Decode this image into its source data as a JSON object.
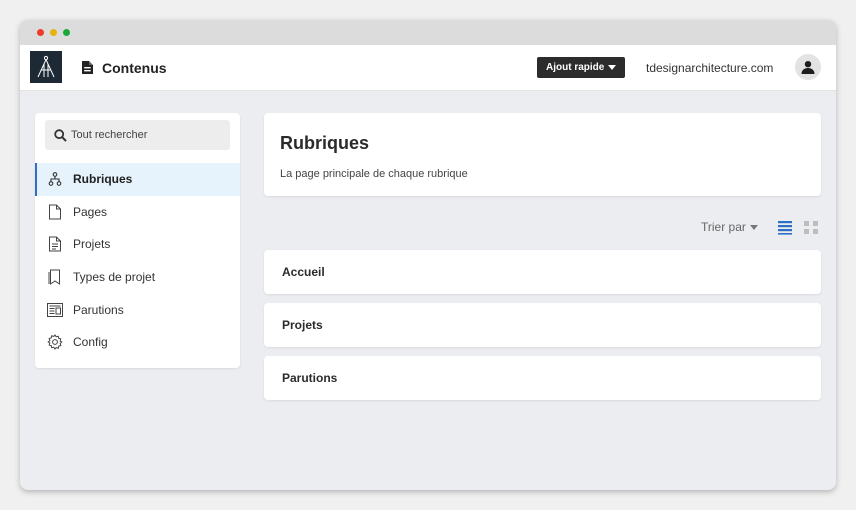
{
  "header": {
    "title": "Contenus",
    "quick_add_label": "Ajout rapide",
    "site": "tdesignarchitecture.com"
  },
  "sidebar": {
    "search_placeholder": "Tout rechercher",
    "items": [
      {
        "label": "Rubriques",
        "icon": "sitemap-icon",
        "active": true
      },
      {
        "label": "Pages",
        "icon": "page-icon"
      },
      {
        "label": "Projets",
        "icon": "document-icon"
      },
      {
        "label": "Types de projet",
        "icon": "bookmark-icon"
      },
      {
        "label": "Parutions",
        "icon": "newspaper-icon"
      },
      {
        "label": "Config",
        "icon": "gear-icon"
      }
    ]
  },
  "main": {
    "title": "Rubriques",
    "subtitle": "La page principale de chaque rubrique",
    "sort_label": "Trier par",
    "rows": [
      {
        "label": "Accueil"
      },
      {
        "label": "Projets"
      },
      {
        "label": "Parutions"
      }
    ]
  },
  "colors": {
    "accent": "#2f6fc4",
    "active_bg": "#e7f3fc",
    "button_dark": "#2c2c2c"
  }
}
